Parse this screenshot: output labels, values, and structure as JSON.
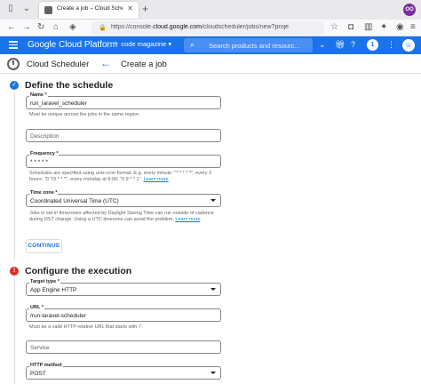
{
  "browser": {
    "tab_title": "Create a job – Cloud Scheduler",
    "url_prefix": "https://console.",
    "url_domain": "cloud.google.com",
    "url_rest": "/cloudscheduler/jobs/new?proje",
    "profile_initials": "OO"
  },
  "header": {
    "brand": "Google Cloud Platform",
    "project": "code magazine",
    "search_placeholder": "Search products and resourc...",
    "notifications_count": "1",
    "accent_color": "#1a73e8"
  },
  "subheader": {
    "service_name": "Cloud Scheduler",
    "page_title": "Create a job"
  },
  "step1": {
    "title": "Define the schedule",
    "status": "complete",
    "name": {
      "label": "Name *",
      "value": "run_laravel_scheduler",
      "hint": "Must be unique across the jobs in the same region"
    },
    "description": {
      "placeholder": "Description"
    },
    "frequency": {
      "label": "Frequency *",
      "value": "* * * * *",
      "hint": "Schedules are specified using unix-cron format. E.g. every minute: \"* * * * *\", every 3 hours: \"0 */3 * * *\", every monday at 9:00: \"0 9 * * 1\".",
      "hint_link": "Learn more"
    },
    "timezone": {
      "label": "Time zone *",
      "value": "Coordinated Universal Time (UTC)",
      "hint": "Jobs in set in timezones affected by Daylight Saving Time can run outside of cadence during DST change. Using a UTC timezone can avoid the problem.",
      "hint_link": "Learn more"
    },
    "continue_label": "CONTINUE"
  },
  "step2": {
    "title": "Configure the execution",
    "status": "error",
    "target_type": {
      "label": "Target type *",
      "value": "App Engine HTTP"
    },
    "url": {
      "label": "URL *",
      "value": "/run-laravel-scheduler",
      "hint": "Must be a valid HTTP relative URL that starts with '/'."
    },
    "service": {
      "placeholder": "Service"
    },
    "http_method": {
      "label": "HTTP method",
      "value": "POST"
    }
  }
}
